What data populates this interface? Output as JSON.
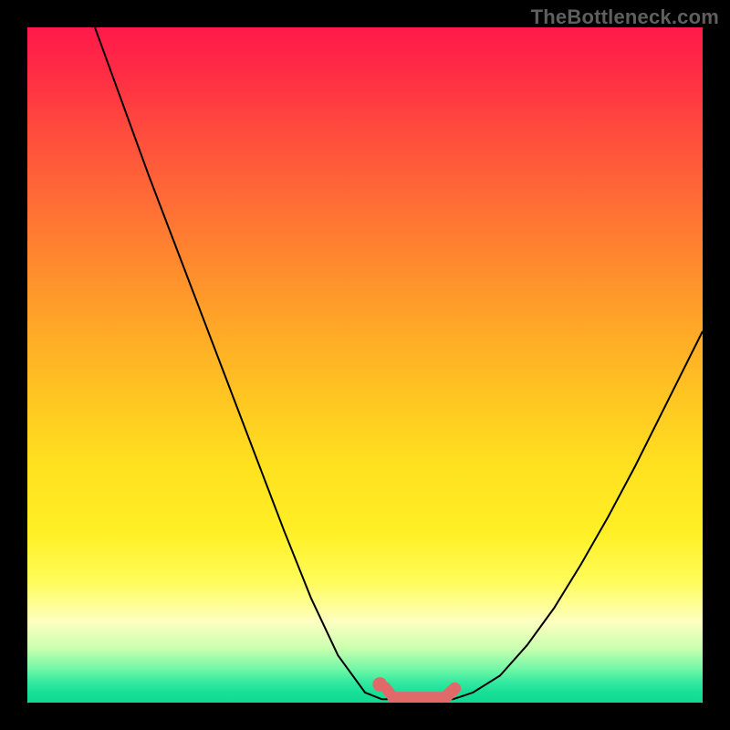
{
  "watermark": "TheBottleneck.com",
  "colors": {
    "frame": "#000000",
    "curve": "#000000",
    "marker": "#e06a6a",
    "watermark": "#5f5f5f"
  },
  "chart_data": {
    "type": "line",
    "title": "",
    "xlabel": "",
    "ylabel": "",
    "xlim": [
      0,
      100
    ],
    "ylim": [
      0,
      100
    ],
    "grid": false,
    "legend": false,
    "series": [
      {
        "name": "left-branch",
        "x": [
          10,
          14,
          18,
          22,
          26,
          30,
          34,
          38,
          42,
          46,
          50,
          52.5
        ],
        "y": [
          100,
          89,
          78,
          67.5,
          57,
          46.5,
          36,
          25.5,
          15.5,
          7,
          1.5,
          0.5
        ]
      },
      {
        "name": "right-branch",
        "x": [
          63,
          66,
          70,
          74,
          78,
          82,
          86,
          90,
          94,
          98,
          100
        ],
        "y": [
          0.5,
          1.5,
          4,
          8.5,
          14,
          20.5,
          27.5,
          35,
          43,
          51,
          55
        ]
      },
      {
        "name": "flat-bottom",
        "x": [
          52.5,
          63
        ],
        "y": [
          0.5,
          0.5
        ]
      }
    ],
    "markers": [
      {
        "shape": "dot",
        "x": 52.2,
        "y": 2.7,
        "r": 1.0
      },
      {
        "shape": "stroke",
        "x1": 53.0,
        "y1": 2.3,
        "x2": 54.2,
        "y2": 0.7,
        "w": 1.6
      },
      {
        "shape": "stroke",
        "x1": 54.2,
        "y1": 0.7,
        "x2": 61.8,
        "y2": 0.7,
        "w": 1.8
      },
      {
        "shape": "stroke",
        "x1": 61.8,
        "y1": 0.7,
        "x2": 63.3,
        "y2": 2.1,
        "w": 1.8
      }
    ],
    "gradient_stops": [
      {
        "pos": 0,
        "color": "#ff1a4a"
      },
      {
        "pos": 0.5,
        "color": "#ffc622"
      },
      {
        "pos": 0.88,
        "color": "#fdffc0"
      },
      {
        "pos": 1.0,
        "color": "#0fd992"
      }
    ]
  }
}
